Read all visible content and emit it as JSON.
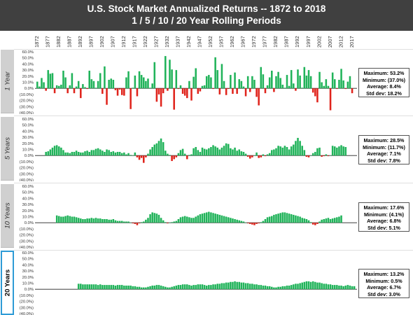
{
  "title": "U.S. Stock Market Annualized Returns  -- 1872 to 2018",
  "subtitle": "1 / 5 / 10 / 20 Year Rolling Periods",
  "colors": {
    "positive": "#21b35a",
    "negative": "#e0241c",
    "header": "#404040",
    "selected": "#2e9bd6"
  },
  "year_labels": [
    "1872",
    "1877",
    "1882",
    "1887",
    "1892",
    "1897",
    "1902",
    "1907",
    "1912",
    "1917",
    "1922",
    "1927",
    "1932",
    "1937",
    "1942",
    "1947",
    "1952",
    "1957",
    "1962",
    "1967",
    "1972",
    "1977",
    "1982",
    "1987",
    "1992",
    "1997",
    "2002",
    "2007",
    "2012",
    "2017"
  ],
  "tick_labels": [
    "60.0%",
    "50.0%",
    "40.0%",
    "30.0%",
    "20.0%",
    "10.0%",
    "0.0%",
    "(10.0%)",
    "(20.0%)",
    "(30.0%)",
    "(40.0%)"
  ],
  "chart_data": [
    {
      "type": "bar",
      "panel": "1 Year",
      "selected": false,
      "x_start": 1872,
      "x_end": 2018,
      "ylim": [
        -40,
        60
      ],
      "values": [
        11,
        3,
        17,
        10,
        -4,
        30,
        24,
        25,
        -8,
        5,
        4,
        6,
        29,
        18,
        -8,
        5,
        25,
        -8,
        3,
        12,
        -16,
        7,
        2,
        -1,
        29,
        15,
        12,
        1,
        12,
        25,
        -9,
        36,
        -27,
        14,
        16,
        14,
        -3,
        -12,
        -2,
        -11,
        -12,
        18,
        28,
        -34,
        1,
        21,
        -13,
        28,
        22,
        18,
        12,
        16,
        1,
        8,
        43,
        -22,
        -10,
        -30,
        -8,
        53,
        -4,
        47,
        31,
        -35,
        30,
        -1,
        5,
        -9,
        -12,
        -16,
        12,
        -20,
        19,
        33,
        -9,
        -5,
        4,
        5,
        20,
        22,
        18,
        -1,
        51,
        30,
        -10,
        40,
        12,
        -11,
        -1,
        22,
        -9,
        26,
        -9,
        15,
        12,
        3,
        -13,
        20,
        -6,
        20,
        14,
        -14,
        -28,
        35,
        23,
        -8,
        5,
        18,
        29,
        -6,
        20,
        27,
        17,
        6,
        1,
        22,
        4,
        30,
        8,
        -4,
        31,
        21,
        1,
        35,
        21,
        30,
        20,
        -7,
        -13,
        -23,
        27,
        10,
        4,
        15,
        4,
        -36,
        26,
        15,
        -1,
        14,
        32,
        13,
        -1,
        11,
        20,
        -8
      ],
      "stats": {
        "maximum": "Maximum: 53.2%",
        "minimum": "Minimum: (37.0%)",
        "average": "Average: 8.4%",
        "std_dev": "Std dev: 18.2%"
      }
    },
    {
      "type": "bar",
      "panel": "5 Years",
      "selected": false,
      "x_start": 1876,
      "x_end": 2018,
      "ylim": [
        -40,
        60
      ],
      "values": [
        6,
        7,
        10,
        13,
        16,
        17,
        15,
        13,
        9,
        5,
        5,
        4,
        6,
        6,
        8,
        6,
        5,
        5,
        7,
        8,
        6,
        9,
        9,
        11,
        12,
        10,
        8,
        6,
        10,
        9,
        6,
        7,
        5,
        6,
        6,
        4,
        5,
        2,
        4,
        1,
        0,
        5,
        -3,
        -7,
        -4,
        -12,
        -3,
        3,
        10,
        14,
        18,
        20,
        24,
        28,
        22,
        8,
        3,
        1,
        -9,
        -6,
        -3,
        4,
        9,
        11,
        3,
        -6,
        1,
        2,
        12,
        14,
        9,
        6,
        13,
        11,
        10,
        12,
        14,
        17,
        15,
        13,
        10,
        13,
        16,
        20,
        19,
        12,
        10,
        13,
        8,
        10,
        7,
        6,
        3,
        -2,
        -5,
        -3,
        0,
        5,
        -4,
        -3,
        2,
        -1,
        2,
        4,
        9,
        10,
        12,
        16,
        15,
        13,
        16,
        14,
        10,
        15,
        18,
        24,
        29,
        24,
        16,
        9,
        -2,
        -3,
        0,
        4,
        6,
        12,
        13,
        -2,
        -1,
        2,
        -1,
        0,
        16,
        15,
        13,
        15,
        17,
        15,
        14
      ],
      "stats": {
        "maximum": "Maximum: 28.5%",
        "minimum": "Minimum: (11.7%)",
        "average": "Average: 7.1%",
        "std_dev": "Std dev: 7.8%"
      }
    },
    {
      "type": "bar",
      "panel": "10 Years",
      "selected": false,
      "x_start": 1881,
      "x_end": 2018,
      "ylim": [
        -40,
        60
      ],
      "values": [
        12,
        11,
        10,
        10,
        11,
        12,
        11,
        10,
        10,
        9,
        8,
        7,
        6,
        6,
        7,
        7,
        8,
        7,
        8,
        7,
        7,
        6,
        6,
        6,
        5,
        5,
        6,
        4,
        3,
        3,
        3,
        2,
        2,
        2,
        0,
        -1,
        -2,
        -4,
        -1,
        1,
        2,
        5,
        8,
        14,
        17,
        16,
        15,
        13,
        8,
        4,
        1,
        -1,
        0,
        1,
        2,
        3,
        6,
        9,
        10,
        11,
        10,
        9,
        8,
        8,
        10,
        12,
        14,
        15,
        16,
        17,
        18,
        17,
        16,
        15,
        14,
        13,
        12,
        11,
        10,
        9,
        8,
        7,
        6,
        5,
        4,
        3,
        2,
        0,
        -1,
        -2,
        -3,
        -4,
        -2,
        -1,
        1,
        3,
        6,
        9,
        10,
        11,
        13,
        14,
        15,
        16,
        17,
        17,
        16,
        15,
        14,
        13,
        12,
        11,
        10,
        8,
        7,
        6,
        4,
        1,
        -3,
        -4,
        -2,
        2,
        5,
        6,
        7,
        8,
        6,
        7,
        8,
        9,
        10,
        12
      ],
      "stats": {
        "maximum": "Maximum: 17.6%",
        "minimum": "Minimum: (4.1%)",
        "average": "Average: 6.8%",
        "std_dev": "Std dev: 5.1%"
      }
    },
    {
      "type": "bar",
      "panel": "20 Years",
      "selected": true,
      "x_start": 1891,
      "x_end": 2018,
      "ylim": [
        -40,
        60
      ],
      "values": [
        9,
        9,
        8,
        8,
        8,
        8,
        8,
        8,
        8,
        7,
        8,
        7,
        7,
        7,
        7,
        7,
        7,
        6,
        7,
        7,
        7,
        6,
        6,
        6,
        6,
        5,
        5,
        4,
        4,
        3,
        3,
        3,
        4,
        5,
        6,
        6,
        7,
        7,
        6,
        5,
        4,
        3,
        3,
        4,
        5,
        6,
        7,
        7,
        8,
        8,
        8,
        7,
        6,
        7,
        7,
        8,
        8,
        8,
        7,
        6,
        7,
        7,
        8,
        8,
        9,
        9,
        10,
        10,
        11,
        11,
        12,
        12,
        13,
        12,
        12,
        11,
        11,
        10,
        10,
        9,
        9,
        8,
        8,
        7,
        7,
        6,
        6,
        5,
        5,
        4,
        3,
        3,
        4,
        4,
        5,
        5,
        6,
        6,
        7,
        8,
        9,
        9,
        10,
        11,
        12,
        13,
        13,
        12,
        13,
        12,
        11,
        11,
        10,
        9,
        9,
        8,
        8,
        7,
        7,
        7,
        6,
        6,
        5,
        6,
        7,
        6,
        5,
        5
      ],
      "stats": {
        "maximum": "Maximum: 13.2%",
        "minimum": "Minimum: 0.5%",
        "average": "Average: 6.7%",
        "std_dev": "Std dev: 3.0%"
      }
    }
  ]
}
